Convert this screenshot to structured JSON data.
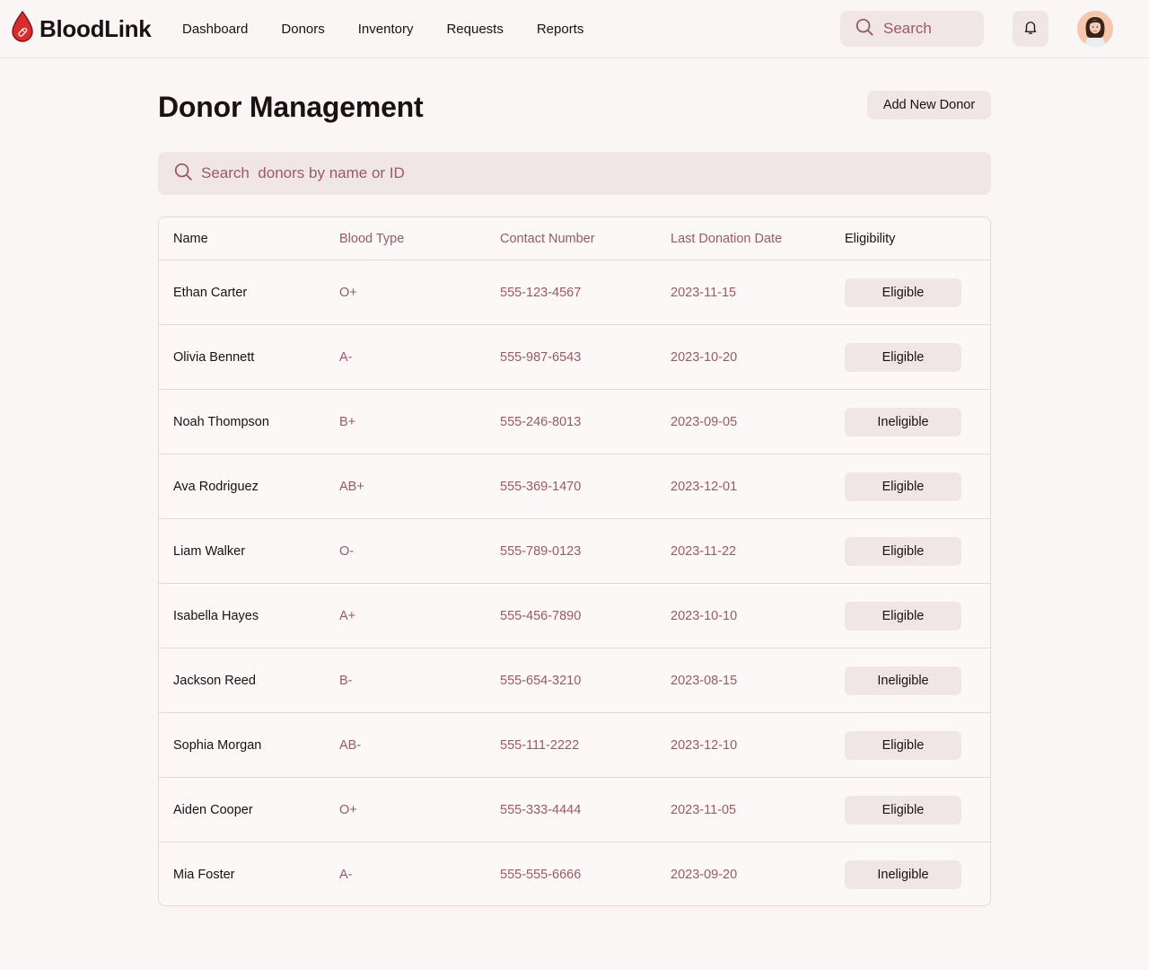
{
  "app": {
    "name": "BloodLink"
  },
  "nav": {
    "items": [
      "Dashboard",
      "Donors",
      "Inventory",
      "Requests",
      "Reports"
    ]
  },
  "header": {
    "search_placeholder": "Search",
    "icons": [
      "search-icon",
      "bell-icon",
      "avatar"
    ]
  },
  "page": {
    "title": "Donor Management",
    "add_button": "Add New Donor",
    "search_placeholder": "Search  donors by name or ID"
  },
  "table": {
    "columns": [
      "Name",
      "Blood Type",
      "Contact Number",
      "Last Donation Date",
      "Eligibility"
    ],
    "rows": [
      {
        "name": "Ethan Carter",
        "blood_type": "O+",
        "contact": "555-123-4567",
        "last_donation": "2023-11-15",
        "eligibility": "Eligible"
      },
      {
        "name": "Olivia Bennett",
        "blood_type": "A-",
        "contact": "555-987-6543",
        "last_donation": "2023-10-20",
        "eligibility": "Eligible"
      },
      {
        "name": "Noah Thompson",
        "blood_type": "B+",
        "contact": "555-246-8013",
        "last_donation": "2023-09-05",
        "eligibility": "Ineligible"
      },
      {
        "name": "Ava Rodriguez",
        "blood_type": "AB+",
        "contact": "555-369-1470",
        "last_donation": "2023-12-01",
        "eligibility": "Eligible"
      },
      {
        "name": "Liam Walker",
        "blood_type": "O-",
        "contact": "555-789-0123",
        "last_donation": "2023-11-22",
        "eligibility": "Eligible"
      },
      {
        "name": "Isabella Hayes",
        "blood_type": "A+",
        "contact": "555-456-7890",
        "last_donation": "2023-10-10",
        "eligibility": "Eligible"
      },
      {
        "name": "Jackson Reed",
        "blood_type": "B-",
        "contact": "555-654-3210",
        "last_donation": "2023-08-15",
        "eligibility": "Ineligible"
      },
      {
        "name": "Sophia Morgan",
        "blood_type": "AB-",
        "contact": "555-111-2222",
        "last_donation": "2023-12-10",
        "eligibility": "Eligible"
      },
      {
        "name": "Aiden Cooper",
        "blood_type": "O+",
        "contact": "555-333-4444",
        "last_donation": "2023-11-05",
        "eligibility": "Eligible"
      },
      {
        "name": "Mia Foster",
        "blood_type": "A-",
        "contact": "555-555-6666",
        "last_donation": "2023-09-20",
        "eligibility": "Ineligible"
      }
    ]
  },
  "colors": {
    "background": "#faf6f5",
    "accent_muted": "#f1e6e6",
    "text_primary": "#1c1112",
    "text_secondary": "#9a5a62",
    "brand_red": "#d92d2d",
    "border": "#e6d9d9"
  }
}
